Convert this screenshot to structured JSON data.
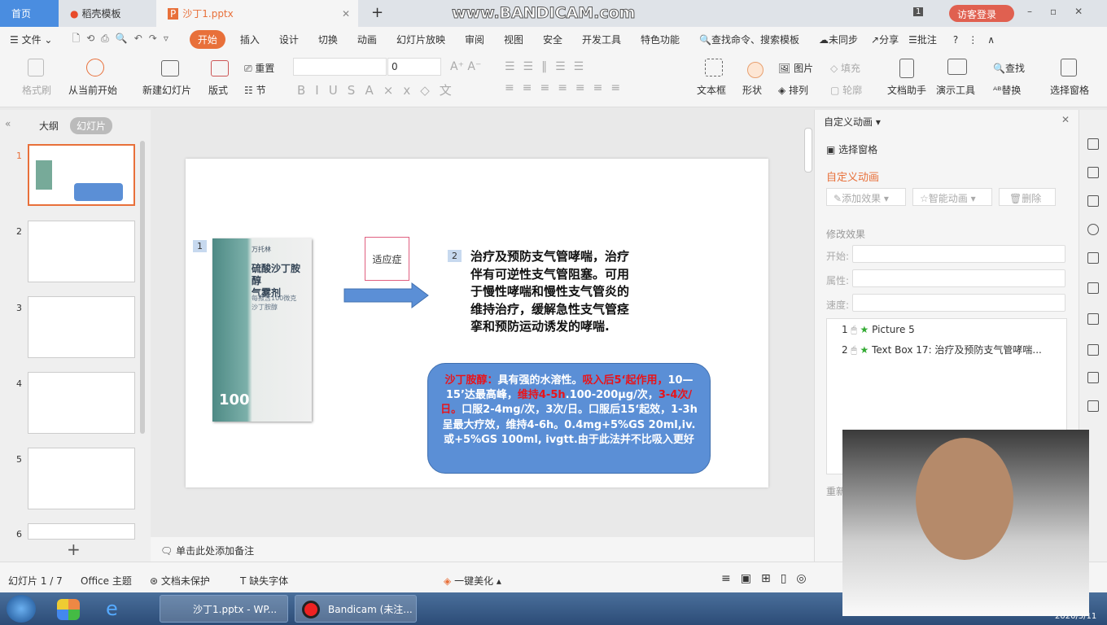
{
  "titlebar": {
    "tabs": [
      "首页",
      "稻壳模板",
      "沙丁1.pptx"
    ],
    "watermark": "www.BANDICAM.com",
    "badge": "1",
    "login": "访客登录"
  },
  "menu": {
    "file": "文件",
    "items": [
      "开始",
      "插入",
      "设计",
      "切换",
      "动画",
      "幻灯片放映",
      "审阅",
      "视图",
      "安全",
      "开发工具",
      "特色功能"
    ],
    "search": "查找命令、搜索模板",
    "sync": "未同步",
    "share": "分享",
    "comment": "批注"
  },
  "ribbon": {
    "format_painter": "格式刷",
    "from_start": "从当前开始",
    "new_slide": "新建幻灯片",
    "layout": "版式",
    "reset": "重置",
    "section": "节",
    "font_size": "0",
    "textbox": "文本框",
    "shape": "形状",
    "picture": "图片",
    "fill": "填充",
    "arrange": "排列",
    "outline": "轮廓",
    "doc_helper": "文档助手",
    "present_tools": "演示工具",
    "find": "查找",
    "replace": "替换",
    "select_pane": "选择窗格"
  },
  "left": {
    "tabs": [
      "大纲",
      "幻灯片"
    ],
    "slides": [
      "1",
      "2",
      "3",
      "4",
      "5",
      "6"
    ]
  },
  "slide": {
    "tag1": "1",
    "tag2": "2",
    "box_label": "适应症",
    "drug_label": [
      "万托林",
      "硫酸沙丁胺醇",
      "气雾剂",
      "每揿含100微克",
      "沙丁胺醇",
      "100"
    ],
    "main_text": "治疗及预防支气管哮喘，治疗伴有可逆性支气管阻塞。可用于慢性哮喘和慢性支气管炎的维持治疗，缓解急性支气管痉挛和预防运动诱发的哮喘.",
    "info": [
      {
        "t": "沙丁胺醇：",
        "red": true
      },
      {
        "t": "具有强的水溶性。",
        "red": false
      },
      {
        "t": "吸入后5‘起作用，",
        "red": true
      },
      {
        "t": "10—15’达最高峰，",
        "red": false
      },
      {
        "t": "维持4-5h",
        "red": true
      },
      {
        "t": ".100-200μg/次，",
        "red": false
      },
      {
        "t": "3-4次/日。",
        "red": true
      },
      {
        "t": "口服2-4mg/次，3次/日。口服后15‘起效，1-3h呈最大疗效，维持4-6h。0.4mg+5%GS 20ml,iv. 或+5%GS 100ml, ivgtt.由于此法并不比吸入更好",
        "red": false
      }
    ]
  },
  "notes": "单击此处添加备注",
  "pane": {
    "header": "自定义动画",
    "select_pane": "选择窗格",
    "title": "自定义动画",
    "add_effect": "添加效果",
    "smart_anim": "智能动画",
    "delete": "删除",
    "modify": "修改效果",
    "start": "开始:",
    "property": "属性:",
    "speed": "速度:",
    "items": [
      {
        "n": "1",
        "label": "Picture 5"
      },
      {
        "n": "2",
        "label": "Text Box 17: 治疗及预防支气管哮喘..."
      }
    ],
    "reorder": "重新"
  },
  "status": {
    "slide": "幻灯片 1 / 7",
    "theme": "Office 主题",
    "protect": "文档未保护",
    "font": "缺失字体",
    "beautify": "一键美化"
  },
  "taskbar": {
    "items": [
      "沙丁1.pptx - WP...",
      "Bandicam (未注..."
    ],
    "date": "2020/5/11"
  },
  "colors": {
    "accent": "#e8703a",
    "info_bg": "#5b8fd6",
    "red": "#e8141b",
    "arrow": "#5b8fd6"
  }
}
